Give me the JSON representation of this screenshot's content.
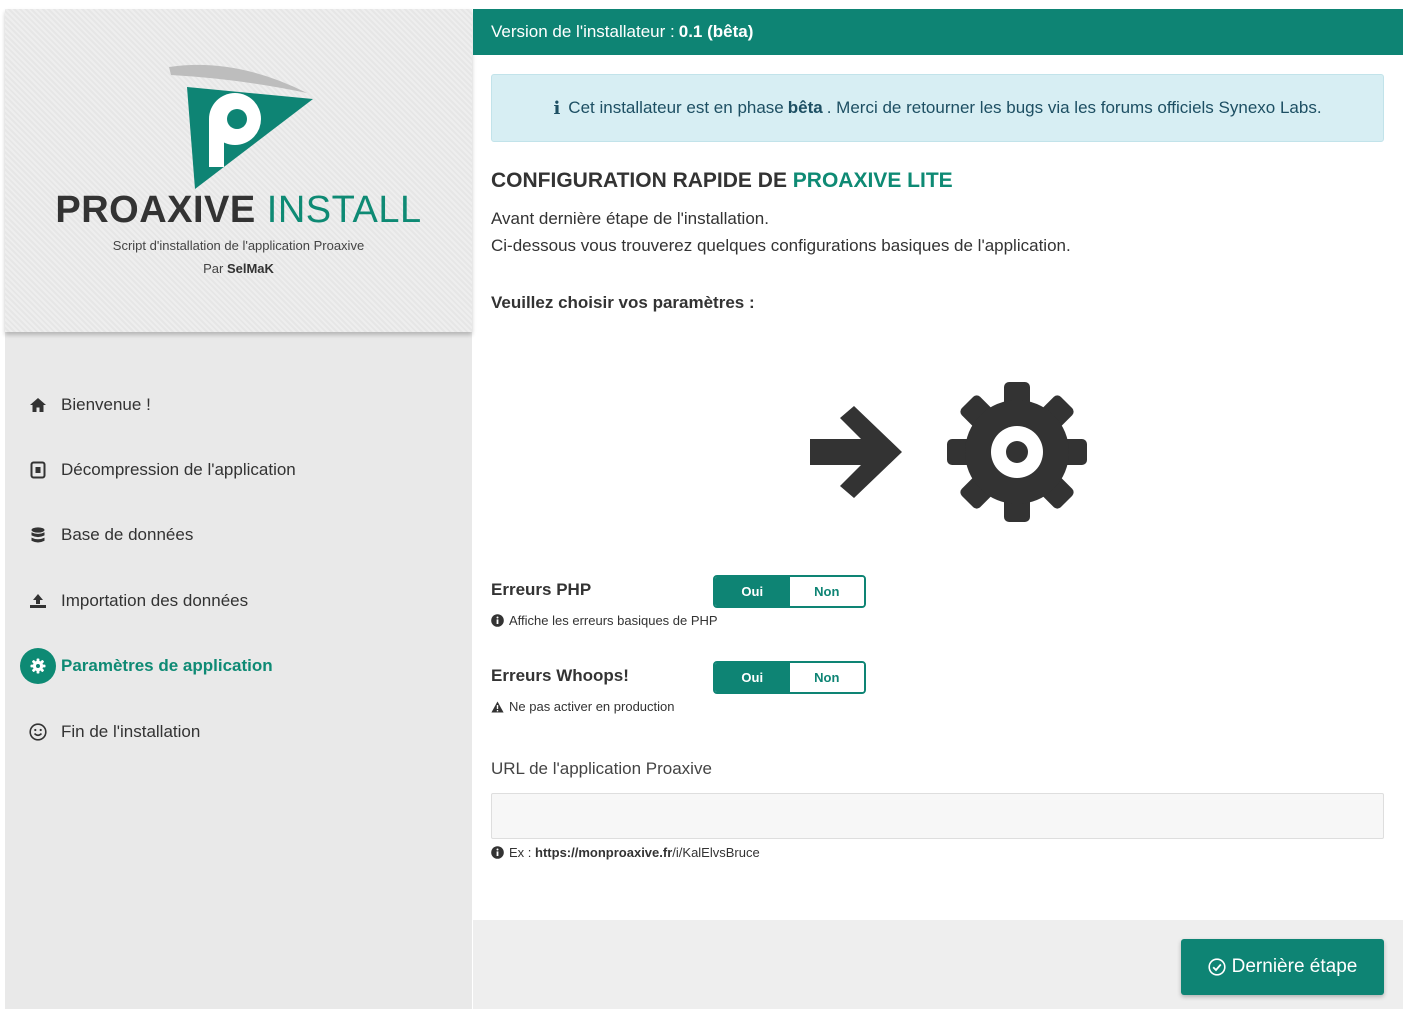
{
  "sidebar": {
    "brand": {
      "title_bold": "PROAXIVE",
      "title_light": "INSTALL",
      "subtitle": "Script d'installation de l'application Proaxive",
      "by_prefix": "Par",
      "author": "SelMaK"
    },
    "nav": [
      {
        "label": "Bienvenue !",
        "icon": "home-icon",
        "active": false
      },
      {
        "label": "Décompression de l'application",
        "icon": "archive-icon",
        "active": false
      },
      {
        "label": "Base de données",
        "icon": "database-icon",
        "active": false
      },
      {
        "label": "Importation des données",
        "icon": "upload-icon",
        "active": false
      },
      {
        "label": "Paramètres de application",
        "icon": "gear-icon",
        "active": true
      },
      {
        "label": "Fin de l'installation",
        "icon": "smile-icon",
        "active": false
      }
    ]
  },
  "topbar": {
    "label": "Version de l'installateur :",
    "version": "0.1 (bêta)"
  },
  "alert": {
    "icon": "info-icon",
    "text_before": "Cet installateur est en phase",
    "text_bold": "bêta",
    "text_after": ". Merci de retourner les bugs via les forums officiels Synexo Labs."
  },
  "main": {
    "title_prefix": "CONFIGURATION RAPIDE DE",
    "title_accent": "PROAXIVE LITE",
    "intro_line1": "Avant dernière étape de l'installation.",
    "intro_line2": "Ci-dessous vous trouverez quelques configurations basiques de l'application.",
    "choose_label": "Veuillez choisir vos paramètres :"
  },
  "options": [
    {
      "label": "Erreurs PHP",
      "on": "Oui",
      "off": "Non",
      "selected": "Oui",
      "hint": "Affiche les erreurs basiques de PHP",
      "hint_icon": "info-circle-icon"
    },
    {
      "label": "Erreurs Whoops!",
      "on": "Oui",
      "off": "Non",
      "selected": "Oui",
      "hint": "Ne pas activer en production",
      "hint_icon": "warning-icon"
    }
  ],
  "url_field": {
    "label": "URL de l'application Proaxive",
    "value": "",
    "placeholder": "",
    "example_prefix": "Ex :",
    "example_bold": "https://monproaxive.fr",
    "example_rest": "/i/KalElvsBruce"
  },
  "footer": {
    "next_button": "Dernière étape",
    "next_icon": "check-circle-icon"
  },
  "colors": {
    "accent": "#0e8474",
    "accent_text": "#0e8a74",
    "alert_bg": "#d7eef3",
    "sidebar_bg": "#e9e9e9"
  }
}
